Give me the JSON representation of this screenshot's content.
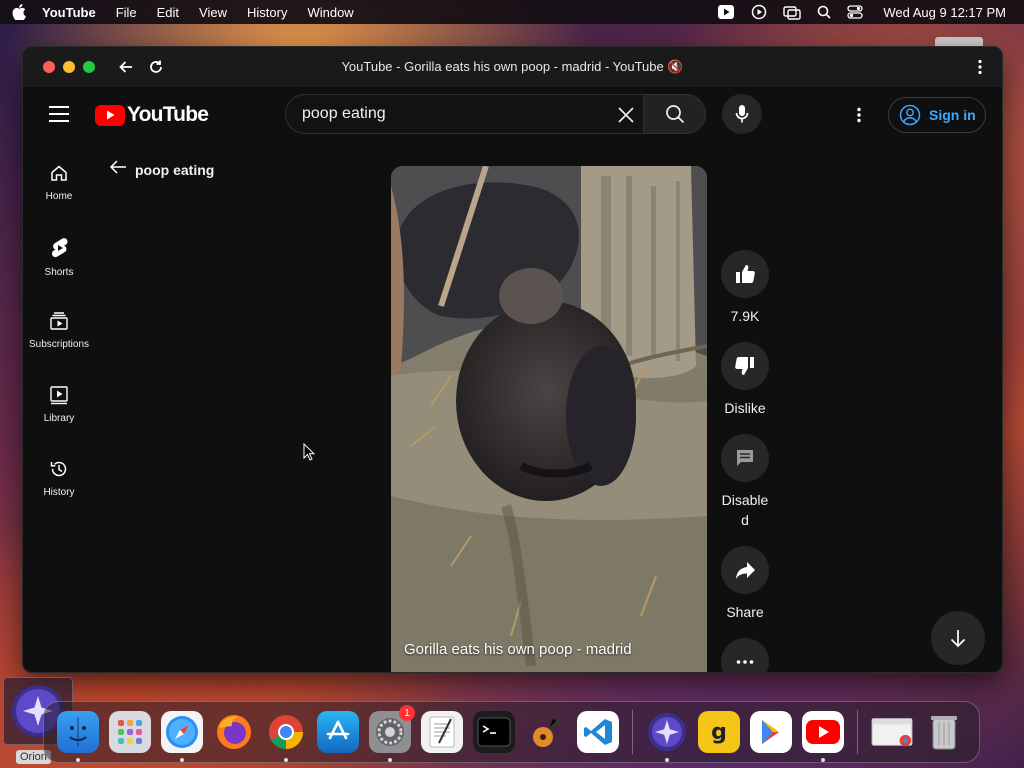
{
  "menubar": {
    "app_name": "YouTube",
    "menus": [
      "File",
      "Edit",
      "View",
      "History",
      "Window"
    ],
    "clock": "Wed Aug 9  12:17 PM"
  },
  "window": {
    "title": "YouTube - Gorilla eats his own poop - madrid - YouTube 🔇"
  },
  "header": {
    "logo_text": "YouTube",
    "search": {
      "value": "poop eating",
      "placeholder": "Search"
    },
    "signin_label": "Sign in"
  },
  "sidebar": {
    "items": [
      {
        "label": "Home",
        "icon": "home-icon"
      },
      {
        "label": "Shorts",
        "icon": "shorts-icon"
      },
      {
        "label": "Subscriptions",
        "icon": "subscriptions-icon"
      },
      {
        "label": "Library",
        "icon": "library-icon"
      },
      {
        "label": "History",
        "icon": "history-icon"
      }
    ]
  },
  "query": "poop eating",
  "video": {
    "title": "Gorilla eats his own poop - madrid"
  },
  "actions": {
    "like_count": "7.9K",
    "dislike_label": "Dislike",
    "comments_label": "Disable\nd",
    "share_label": "Share"
  },
  "dock": {
    "orion_label": "Orion",
    "settings_badge": "1"
  },
  "colors": {
    "yt_red": "#ff0000",
    "link_blue": "#3ea6ff",
    "bg": "#0f0f0f"
  }
}
